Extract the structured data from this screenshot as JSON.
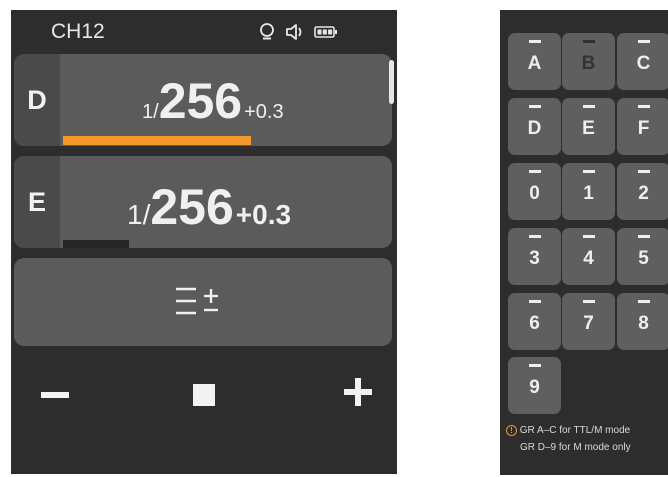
{
  "status": {
    "channel": "CH12",
    "icons": [
      "modeling-lamp-icon",
      "speaker-icon",
      "battery-icon"
    ]
  },
  "groups": [
    {
      "label": "D",
      "power_prefix": "1/",
      "power_value": "256",
      "compensation": "+0.3",
      "level_bar_color": "#f39a2a",
      "selected": true
    },
    {
      "label": "E",
      "power_prefix": "1/",
      "power_value": "256",
      "compensation": "+0.3",
      "level_bar_color": "#262626",
      "selected": false
    }
  ],
  "menu": {
    "icon": "menu-adjust-icon"
  },
  "controls": {
    "minus_icon": "minus-icon",
    "stop_icon": "stop-icon",
    "plus_icon": "plus-icon"
  },
  "keypad": {
    "keys": [
      "A",
      "B",
      "C",
      "D",
      "E",
      "F",
      "0",
      "1",
      "2",
      "3",
      "4",
      "5",
      "6",
      "7",
      "8",
      "9"
    ],
    "disabled": [
      "B"
    ]
  },
  "notes": {
    "line1": "GR A–C for TTL/M mode",
    "line2": "GR D–9 for M mode only",
    "icon": "info-icon",
    "icon_color": "#e8962a"
  },
  "colors": {
    "panel_bg": "#2d2d2d",
    "row_bg": "#5b5b5b",
    "accent": "#f39a2a"
  }
}
